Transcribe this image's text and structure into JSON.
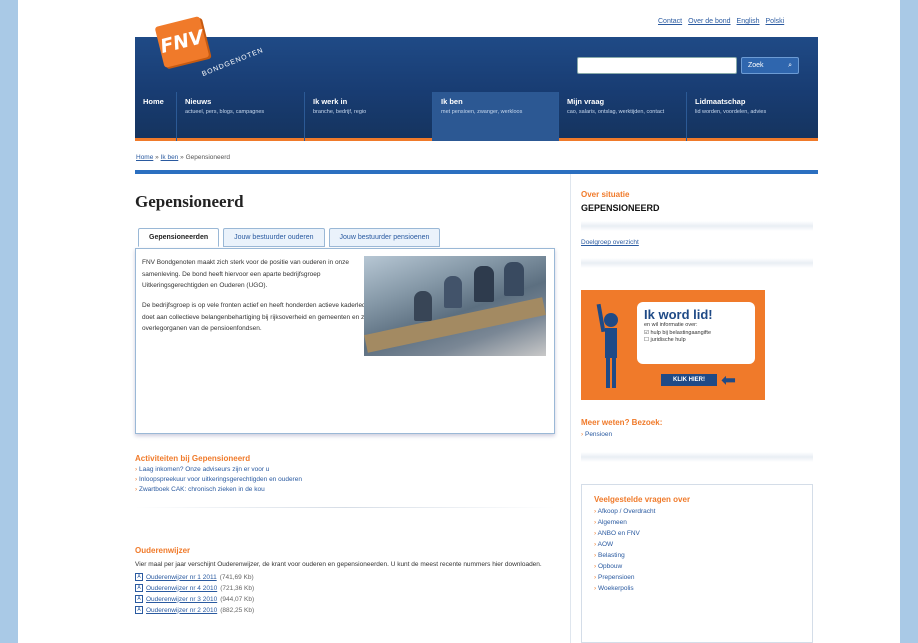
{
  "top_links": [
    "Contact",
    "Over de bond",
    "English",
    "Polski"
  ],
  "logo": {
    "text": "FNV",
    "sub": "BONDGENOTEN"
  },
  "search": {
    "placeholder": "",
    "button": "Zoek",
    "icon": "search-icon"
  },
  "nav": [
    {
      "title": "Home",
      "sub": ""
    },
    {
      "title": "Nieuws",
      "sub": "actueel, pers, blogs, campagnes"
    },
    {
      "title": "Ik werk in",
      "sub": "branche, bedrijf, regio"
    },
    {
      "title": "Ik ben",
      "sub": "met pensioen, zwanger, werkloos"
    },
    {
      "title": "Mijn vraag",
      "sub": "cao, salaris, ontslag, werktijden, contact"
    },
    {
      "title": "Lidmaatschap",
      "sub": "lid worden, voordelen, advies"
    }
  ],
  "breadcrumb": {
    "home": "Home",
    "sep": "»",
    "mid": "Ik ben",
    "current": "Gepensioneerd"
  },
  "page": {
    "title": "Gepensioneerd",
    "tabs": [
      "Gepensioneerden",
      "Jouw bestuurder ouderen",
      "Jouw bestuurder pensioenen"
    ],
    "para1": "FNV Bondgenoten maakt zich sterk voor de positie van ouderen in onze samenleving. De bond heeft hiervoor een aparte bedrijfsgroep Uitkeringsgerechtigden en Ouderen (UGO).",
    "para2": "De bedrijfsgroep is op vele fronten actief en heeft honderden actieve kaderleden. De bedrijfsgroep biedt individuele begeleiding en advies, doet aan collectieve belangenbehartiging bij rijksoverheid en gemeenten en zet zich in voor de medezeggenschap van ouderen in de overlegorganen van de pensioenfondsen."
  },
  "activities": {
    "heading": "Activiteiten bij Gepensioneerd",
    "items": [
      "Laag inkomen? Onze adviseurs zijn er voor u",
      "Inloopspreekuur voor uitkeringsgerechtigden en ouderen",
      "Zwartboek CAK: chronisch zieken in de kou"
    ]
  },
  "ouderen": {
    "heading": "Ouderenwijzer",
    "text": "Vier maal per jaar verschijnt Ouderenwijzer, de krant voor ouderen en gepensioneerden. U kunt de meest recente nummers hier downloaden.",
    "docs": [
      {
        "label": "Ouderenwijzer nr 1 2011",
        "size": "(741,69 Kb)"
      },
      {
        "label": "Ouderenwijzer nr 4 2010",
        "size": "(721,36 Kb)"
      },
      {
        "label": "Ouderenwijzer nr 3 2010",
        "size": "(944,07 Kb)"
      },
      {
        "label": "Ouderenwijzer nr 2 2010",
        "size": "(882,25 Kb)"
      }
    ]
  },
  "sidebar": {
    "about_heading": "Over situatie",
    "about_big": "GEPENSIONEERD",
    "about_link": "Doelgroep overzicht",
    "ad": {
      "title": "Ik word lid!",
      "line1": "en wil informatie over:",
      "opt1": "hulp bij belastingaangifte",
      "opt2": "juridische hulp",
      "cta": "KLIK HIER!"
    },
    "more_heading": "Meer weten? Bezoek:",
    "more_items": [
      "Pensioen"
    ],
    "faq_heading": "Veelgestelde vragen over",
    "faq_items": [
      "Afkoop / Overdracht",
      "Algemeen",
      "ANBO en FNV",
      "AOW",
      "Belasting",
      "Opbouw",
      "Prepensioen",
      "Woekerpolis"
    ]
  }
}
